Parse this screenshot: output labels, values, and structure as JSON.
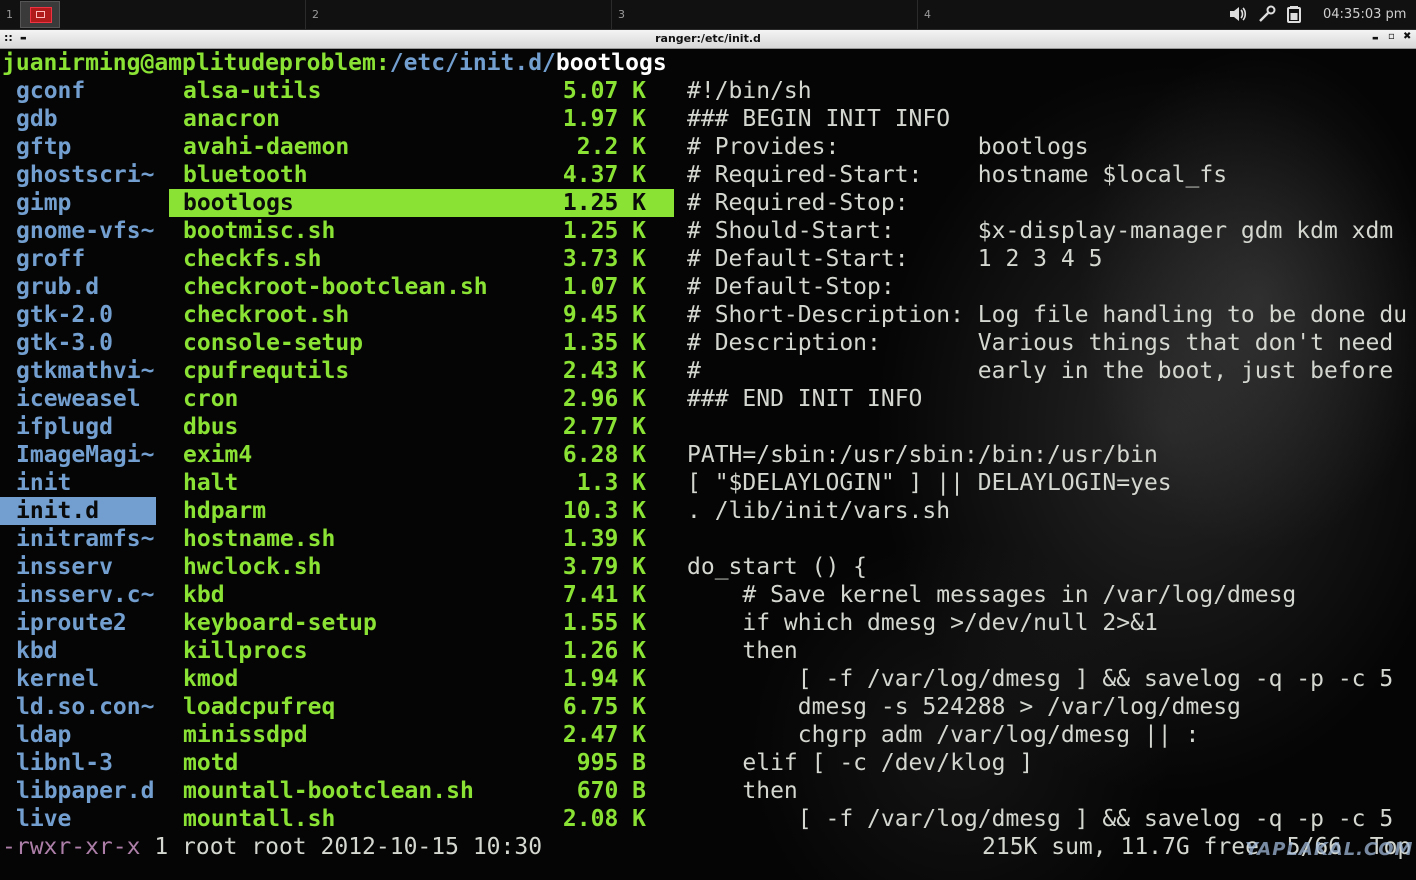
{
  "panel": {
    "workspaces": [
      "1",
      "2",
      "3",
      "4"
    ],
    "clock": "04:35:03 pm",
    "icons": [
      "volume-icon",
      "network-tool-icon",
      "battery-icon"
    ]
  },
  "window": {
    "title": "ranger:/etc/init.d",
    "menu_glyph": "::",
    "min_glyph": "▬",
    "btn_minimize": "▬",
    "btn_maximize": "▫",
    "btn_close": "✖"
  },
  "path": {
    "userhost": "juanirming@amplitudeproblem:",
    "dir": "/etc/init.d/",
    "file": "bootlogs"
  },
  "parent_dirs": [
    "gconf",
    "gdb",
    "gftp",
    "ghostscri~",
    "gimp",
    "gnome-vfs~",
    "groff",
    "grub.d",
    "gtk-2.0",
    "gtk-3.0",
    "gtkmathvi~",
    "iceweasel",
    "ifplugd",
    "ImageMagi~",
    "init",
    "init.d",
    "initramfs~",
    "insserv",
    "insserv.c~",
    "iproute2",
    "kbd",
    "kernel",
    "ld.so.con~",
    "ldap",
    "libnl-3",
    "libpaper.d",
    "live"
  ],
  "parent_selected_index": 15,
  "files": [
    {
      "name": "alsa-utils",
      "size": "5.07 K"
    },
    {
      "name": "anacron",
      "size": "1.97 K"
    },
    {
      "name": "avahi-daemon",
      "size": "2.2 K"
    },
    {
      "name": "bluetooth",
      "size": "4.37 K"
    },
    {
      "name": "bootlogs",
      "size": "1.25 K"
    },
    {
      "name": "bootmisc.sh",
      "size": "1.25 K"
    },
    {
      "name": "checkfs.sh",
      "size": "3.73 K"
    },
    {
      "name": "checkroot-bootclean.sh",
      "size": "1.07 K"
    },
    {
      "name": "checkroot.sh",
      "size": "9.45 K"
    },
    {
      "name": "console-setup",
      "size": "1.35 K"
    },
    {
      "name": "cpufrequtils",
      "size": "2.43 K"
    },
    {
      "name": "cron",
      "size": "2.96 K"
    },
    {
      "name": "dbus",
      "size": "2.77 K"
    },
    {
      "name": "exim4",
      "size": "6.28 K"
    },
    {
      "name": "halt",
      "size": "1.3 K"
    },
    {
      "name": "hdparm",
      "size": "10.3 K"
    },
    {
      "name": "hostname.sh",
      "size": "1.39 K"
    },
    {
      "name": "hwclock.sh",
      "size": "3.79 K"
    },
    {
      "name": "kbd",
      "size": "7.41 K"
    },
    {
      "name": "keyboard-setup",
      "size": "1.55 K"
    },
    {
      "name": "killprocs",
      "size": "1.26 K"
    },
    {
      "name": "kmod",
      "size": "1.94 K"
    },
    {
      "name": "loadcpufreq",
      "size": "6.75 K"
    },
    {
      "name": "minissdpd",
      "size": "2.47 K"
    },
    {
      "name": "motd",
      "size": "995 B"
    },
    {
      "name": "mountall-bootclean.sh",
      "size": "670 B"
    },
    {
      "name": "mountall.sh",
      "size": "2.08 K"
    }
  ],
  "files_selected_index": 4,
  "preview_lines": [
    "#!/bin/sh",
    "### BEGIN INIT INFO",
    "# Provides:          bootlogs",
    "# Required-Start:    hostname $local_fs",
    "# Required-Stop:",
    "# Should-Start:      $x-display-manager gdm kdm xdm",
    "# Default-Start:     1 2 3 4 5",
    "# Default-Stop:",
    "# Short-Description: Log file handling to be done du",
    "# Description:       Various things that don't need",
    "#                    early in the boot, just before",
    "### END INIT INFO",
    "",
    "PATH=/sbin:/usr/sbin:/bin:/usr/bin",
    "[ \"$DELAYLOGIN\" ] || DELAYLOGIN=yes",
    ". /lib/init/vars.sh",
    "",
    "do_start () {",
    "    # Save kernel messages in /var/log/dmesg",
    "    if which dmesg >/dev/null 2>&1",
    "    then",
    "        [ -f /var/log/dmesg ] && savelog -q -p -c 5",
    "        dmesg -s 524288 > /var/log/dmesg",
    "        chgrp adm /var/log/dmesg || :",
    "    elif [ -c /dev/klog ]",
    "    then",
    "        [ -f /var/log/dmesg ] && savelog -q -p -c 5"
  ],
  "status": {
    "permissions": "-rwxr-xr-x",
    "info": " 1 root root 2012-10-15 10:30",
    "summary": "215K sum, 11.7G free  5/66  Top"
  },
  "watermark": "YAPLAKAL.COM"
}
